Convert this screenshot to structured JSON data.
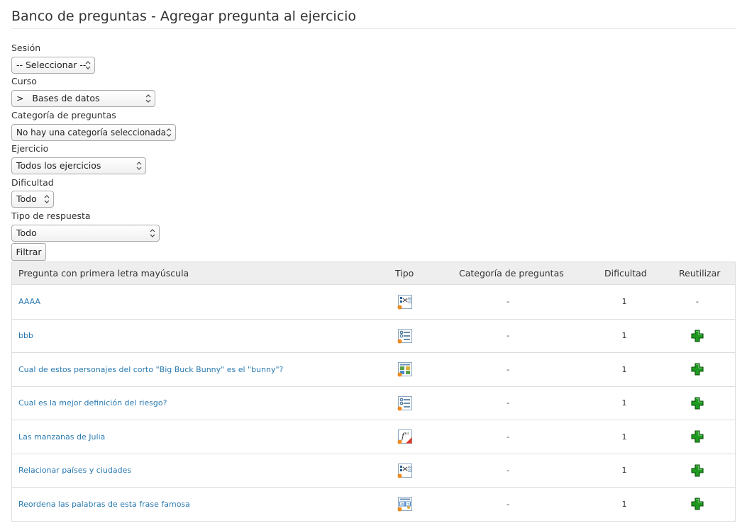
{
  "page": {
    "title": "Banco de preguntas - Agregar pregunta al ejercicio"
  },
  "filters": {
    "session": {
      "label": "Sesión",
      "value": "-- Seleccionar --"
    },
    "course": {
      "label": "Curso",
      "value": ">   Bases de datos"
    },
    "category": {
      "label": "Categoría de preguntas",
      "value": "No hay una categoría seleccionada"
    },
    "exercise": {
      "label": "Ejercicio",
      "value": "Todos los ejercicios"
    },
    "difficulty": {
      "label": "Dificultad",
      "value": "Todo"
    },
    "answer_type": {
      "label": "Tipo de respuesta",
      "value": "Todo"
    },
    "filter_button": "Filtrar"
  },
  "table": {
    "headers": {
      "question": "Pregunta con primera letra mayúscula",
      "type": "Tipo",
      "category": "Categoría de preguntas",
      "difficulty": "Dificultad",
      "reuse": "Reutilizar"
    },
    "rows": [
      {
        "question": "AAAA",
        "type_icon": "matching-icon",
        "category": "-",
        "difficulty": "1",
        "reuse": "-"
      },
      {
        "question": "bbb",
        "type_icon": "multiple-choice-icon",
        "category": "-",
        "difficulty": "1",
        "reuse": "add-icon"
      },
      {
        "question": "Cual de estos personajes del corto \"Big Buck Bunny\" es el \"bunny\"?",
        "type_icon": "image-zones-icon",
        "category": "-",
        "difficulty": "1",
        "reuse": "add-icon"
      },
      {
        "question": "Cual es la mejor definición del riesgo?",
        "type_icon": "multiple-choice-icon",
        "category": "-",
        "difficulty": "1",
        "reuse": "add-icon"
      },
      {
        "question": "Las manzanas de Julia",
        "type_icon": "calculated-formula-icon",
        "category": "-",
        "difficulty": "1",
        "reuse": "add-icon"
      },
      {
        "question": "Relacionar países y ciudades",
        "type_icon": "matching-icon",
        "category": "-",
        "difficulty": "1",
        "reuse": "add-icon"
      },
      {
        "question": "Reordena las palabras de esta frase famosa",
        "type_icon": "ordering-icon",
        "category": "-",
        "difficulty": "1",
        "reuse": "add-icon"
      }
    ]
  },
  "colors": {
    "link": "#2a7ab0",
    "header_bg": "#eeeeee",
    "add_green": "#1e9a1e"
  }
}
